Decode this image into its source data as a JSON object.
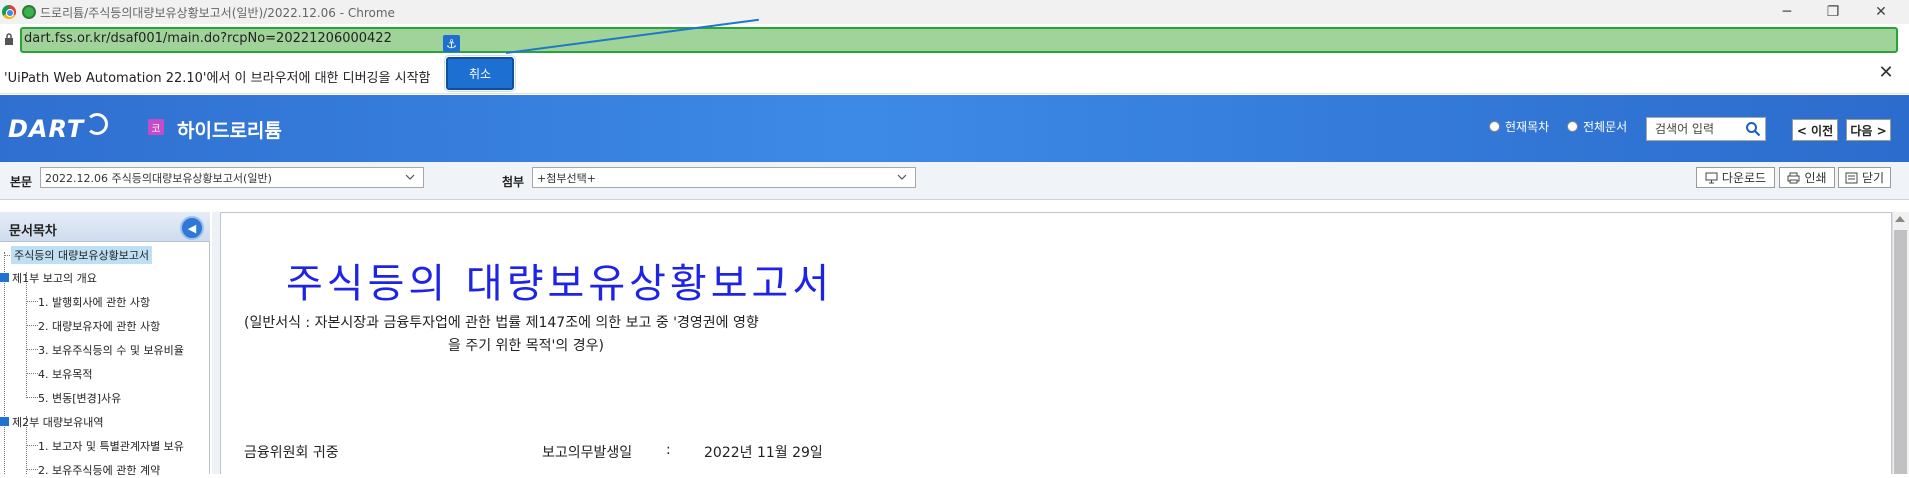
{
  "browser": {
    "window_title": "드로리튬/주식등의대량보유상황보고서(일반)/2022.12.06 - Chrome",
    "url": "dart.fss.or.kr/dsaf001/main.do?rcpNo=20221206000422",
    "window_controls": {
      "minimize": "─",
      "restore": "❐",
      "close": "✕"
    }
  },
  "infobar": {
    "message": "'UiPath Web Automation 22.10'에서 이 브라우저에 대한 디버깅을 시작함",
    "cancel_label": "취소",
    "close": "✕"
  },
  "anchor": {
    "glyph": "⚓"
  },
  "header": {
    "logo": "DART",
    "company_badge": "코",
    "company_name": "하이드로리튬",
    "radio_current": "현재목차",
    "radio_all": "전체문서",
    "search_placeholder": "검색어 입력",
    "prev_label": "< 이전",
    "next_label": "다음 >"
  },
  "toolbar": {
    "body_label": "본문",
    "body_select": "2022.12.06  주식등의대량보유상황보고서(일반)",
    "attach_label": "첨부",
    "attach_select": "+첨부선택+",
    "download_label": "다운로드",
    "print_label": "인쇄",
    "close_label": "닫기"
  },
  "toc": {
    "title": "문서목차",
    "collapse_glyph": "◀",
    "items": [
      "주식등의 대량보유상황보고서",
      "제1부 보고의 개요",
      "1. 발행회사에 관한 사항",
      "2. 대량보유자에 관한 사항",
      "3. 보유주식등의 수 및 보유비율",
      "4. 보유목적",
      "5. 변동[변경]사유",
      "제2부 대량보유내역",
      "1. 보고자 및 특별관계자별 보유",
      "2. 보유주식등에 관한 계약"
    ]
  },
  "document": {
    "title": "주식등의 대량보유상황보고서",
    "subtitle_line1": "(일반서식 : 자본시장과 금융투자업에 관한 법률 제147조에 의한 보고 중 '경영권에 영향",
    "subtitle_line2": "을 주기 위한 목적'의 경우)",
    "recipient": "금융위원회 귀중",
    "date_label": "보고의무발생일",
    "colon": ":",
    "date_value": "2022년 11월 29일"
  }
}
